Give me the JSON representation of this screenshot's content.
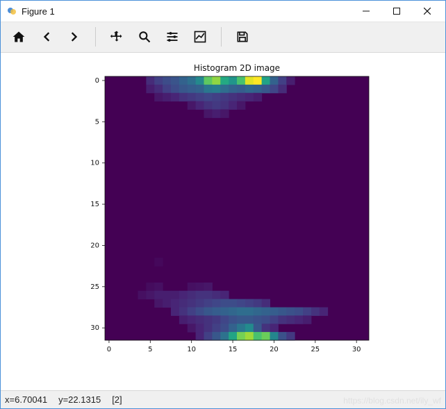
{
  "window": {
    "title": "Figure 1"
  },
  "toolbar": {
    "home": "Home",
    "back": "Back",
    "forward": "Forward",
    "pan": "Pan",
    "zoom": "Zoom",
    "subplots": "Configure subplots",
    "axes": "Edit axes",
    "save": "Save"
  },
  "status": {
    "x": "x=6.70041",
    "y": "y=22.1315",
    "val": "[2]"
  },
  "watermark": "https://blog.csdn.net/ily_wf",
  "chart_data": {
    "type": "heatmap",
    "title": "Histogram 2D image",
    "xlabel": "",
    "ylabel": "",
    "cmap": "viridis",
    "bg_value": 0,
    "xlim": [
      -0.5,
      31.5
    ],
    "ylim": [
      31.5,
      -0.5
    ],
    "xticks": [
      0,
      5,
      10,
      15,
      20,
      25,
      30
    ],
    "yticks": [
      0,
      5,
      10,
      15,
      20,
      25,
      30
    ],
    "width": 32,
    "height": 32,
    "sparse_cells": [
      {
        "y": 0,
        "x": 5,
        "v": 12
      },
      {
        "y": 0,
        "x": 6,
        "v": 18
      },
      {
        "y": 0,
        "x": 7,
        "v": 22
      },
      {
        "y": 0,
        "x": 8,
        "v": 25
      },
      {
        "y": 0,
        "x": 9,
        "v": 30
      },
      {
        "y": 0,
        "x": 10,
        "v": 35
      },
      {
        "y": 0,
        "x": 11,
        "v": 45
      },
      {
        "y": 0,
        "x": 12,
        "v": 72
      },
      {
        "y": 0,
        "x": 13,
        "v": 80
      },
      {
        "y": 0,
        "x": 14,
        "v": 58
      },
      {
        "y": 0,
        "x": 15,
        "v": 50
      },
      {
        "y": 0,
        "x": 16,
        "v": 68
      },
      {
        "y": 0,
        "x": 17,
        "v": 92
      },
      {
        "y": 0,
        "x": 18,
        "v": 96
      },
      {
        "y": 0,
        "x": 19,
        "v": 55
      },
      {
        "y": 0,
        "x": 20,
        "v": 30
      },
      {
        "y": 0,
        "x": 21,
        "v": 18
      },
      {
        "y": 0,
        "x": 22,
        "v": 8
      },
      {
        "y": 1,
        "x": 5,
        "v": 8
      },
      {
        "y": 1,
        "x": 6,
        "v": 12
      },
      {
        "y": 1,
        "x": 7,
        "v": 18
      },
      {
        "y": 1,
        "x": 8,
        "v": 22
      },
      {
        "y": 1,
        "x": 9,
        "v": 26
      },
      {
        "y": 1,
        "x": 10,
        "v": 28
      },
      {
        "y": 1,
        "x": 11,
        "v": 30
      },
      {
        "y": 1,
        "x": 12,
        "v": 38
      },
      {
        "y": 1,
        "x": 13,
        "v": 40
      },
      {
        "y": 1,
        "x": 14,
        "v": 34
      },
      {
        "y": 1,
        "x": 15,
        "v": 30
      },
      {
        "y": 1,
        "x": 16,
        "v": 28
      },
      {
        "y": 1,
        "x": 17,
        "v": 32
      },
      {
        "y": 1,
        "x": 18,
        "v": 30
      },
      {
        "y": 1,
        "x": 19,
        "v": 26
      },
      {
        "y": 1,
        "x": 20,
        "v": 20
      },
      {
        "y": 1,
        "x": 21,
        "v": 12
      },
      {
        "y": 2,
        "x": 6,
        "v": 6
      },
      {
        "y": 2,
        "x": 7,
        "v": 8
      },
      {
        "y": 2,
        "x": 8,
        "v": 10
      },
      {
        "y": 2,
        "x": 9,
        "v": 14
      },
      {
        "y": 2,
        "x": 10,
        "v": 16
      },
      {
        "y": 2,
        "x": 11,
        "v": 18
      },
      {
        "y": 2,
        "x": 12,
        "v": 20
      },
      {
        "y": 2,
        "x": 13,
        "v": 18
      },
      {
        "y": 2,
        "x": 14,
        "v": 16
      },
      {
        "y": 2,
        "x": 15,
        "v": 14
      },
      {
        "y": 2,
        "x": 16,
        "v": 12
      },
      {
        "y": 2,
        "x": 17,
        "v": 10
      },
      {
        "y": 2,
        "x": 18,
        "v": 8
      },
      {
        "y": 3,
        "x": 10,
        "v": 6
      },
      {
        "y": 3,
        "x": 11,
        "v": 10
      },
      {
        "y": 3,
        "x": 12,
        "v": 14
      },
      {
        "y": 3,
        "x": 13,
        "v": 16
      },
      {
        "y": 3,
        "x": 14,
        "v": 14
      },
      {
        "y": 3,
        "x": 15,
        "v": 10
      },
      {
        "y": 3,
        "x": 16,
        "v": 6
      },
      {
        "y": 4,
        "x": 12,
        "v": 6
      },
      {
        "y": 4,
        "x": 13,
        "v": 8
      },
      {
        "y": 4,
        "x": 14,
        "v": 6
      },
      {
        "y": 22,
        "x": 6,
        "v": 2
      },
      {
        "y": 25,
        "x": 5,
        "v": 3
      },
      {
        "y": 25,
        "x": 6,
        "v": 4
      },
      {
        "y": 25,
        "x": 10,
        "v": 4
      },
      {
        "y": 25,
        "x": 11,
        "v": 5
      },
      {
        "y": 25,
        "x": 12,
        "v": 6
      },
      {
        "y": 26,
        "x": 4,
        "v": 4
      },
      {
        "y": 26,
        "x": 5,
        "v": 6
      },
      {
        "y": 26,
        "x": 6,
        "v": 8
      },
      {
        "y": 26,
        "x": 7,
        "v": 8
      },
      {
        "y": 26,
        "x": 8,
        "v": 8
      },
      {
        "y": 26,
        "x": 9,
        "v": 10
      },
      {
        "y": 26,
        "x": 10,
        "v": 12
      },
      {
        "y": 26,
        "x": 11,
        "v": 14
      },
      {
        "y": 26,
        "x": 12,
        "v": 14
      },
      {
        "y": 26,
        "x": 13,
        "v": 12
      },
      {
        "y": 26,
        "x": 14,
        "v": 10
      },
      {
        "y": 27,
        "x": 6,
        "v": 6
      },
      {
        "y": 27,
        "x": 7,
        "v": 8
      },
      {
        "y": 27,
        "x": 8,
        "v": 10
      },
      {
        "y": 27,
        "x": 9,
        "v": 12
      },
      {
        "y": 27,
        "x": 10,
        "v": 14
      },
      {
        "y": 27,
        "x": 11,
        "v": 16
      },
      {
        "y": 27,
        "x": 12,
        "v": 18
      },
      {
        "y": 27,
        "x": 13,
        "v": 20
      },
      {
        "y": 27,
        "x": 14,
        "v": 22
      },
      {
        "y": 27,
        "x": 15,
        "v": 22
      },
      {
        "y": 27,
        "x": 16,
        "v": 20
      },
      {
        "y": 27,
        "x": 17,
        "v": 18
      },
      {
        "y": 27,
        "x": 18,
        "v": 16
      },
      {
        "y": 27,
        "x": 19,
        "v": 12
      },
      {
        "y": 28,
        "x": 8,
        "v": 10
      },
      {
        "y": 28,
        "x": 9,
        "v": 14
      },
      {
        "y": 28,
        "x": 10,
        "v": 18
      },
      {
        "y": 28,
        "x": 11,
        "v": 22
      },
      {
        "y": 28,
        "x": 12,
        "v": 26
      },
      {
        "y": 28,
        "x": 13,
        "v": 28
      },
      {
        "y": 28,
        "x": 14,
        "v": 30
      },
      {
        "y": 28,
        "x": 15,
        "v": 32
      },
      {
        "y": 28,
        "x": 16,
        "v": 34
      },
      {
        "y": 28,
        "x": 17,
        "v": 34
      },
      {
        "y": 28,
        "x": 18,
        "v": 32
      },
      {
        "y": 28,
        "x": 19,
        "v": 30
      },
      {
        "y": 28,
        "x": 20,
        "v": 28
      },
      {
        "y": 28,
        "x": 21,
        "v": 26
      },
      {
        "y": 28,
        "x": 22,
        "v": 24
      },
      {
        "y": 28,
        "x": 23,
        "v": 22
      },
      {
        "y": 28,
        "x": 24,
        "v": 18
      },
      {
        "y": 28,
        "x": 25,
        "v": 14
      },
      {
        "y": 28,
        "x": 26,
        "v": 10
      },
      {
        "y": 29,
        "x": 9,
        "v": 8
      },
      {
        "y": 29,
        "x": 10,
        "v": 10
      },
      {
        "y": 29,
        "x": 11,
        "v": 12
      },
      {
        "y": 29,
        "x": 12,
        "v": 14
      },
      {
        "y": 29,
        "x": 13,
        "v": 16
      },
      {
        "y": 29,
        "x": 14,
        "v": 20
      },
      {
        "y": 29,
        "x": 15,
        "v": 24
      },
      {
        "y": 29,
        "x": 16,
        "v": 26
      },
      {
        "y": 29,
        "x": 17,
        "v": 26
      },
      {
        "y": 29,
        "x": 18,
        "v": 24
      },
      {
        "y": 29,
        "x": 19,
        "v": 22
      },
      {
        "y": 29,
        "x": 20,
        "v": 18
      },
      {
        "y": 29,
        "x": 21,
        "v": 14
      },
      {
        "y": 29,
        "x": 22,
        "v": 12
      },
      {
        "y": 29,
        "x": 23,
        "v": 10
      },
      {
        "y": 29,
        "x": 24,
        "v": 8
      },
      {
        "y": 30,
        "x": 10,
        "v": 6
      },
      {
        "y": 30,
        "x": 11,
        "v": 10
      },
      {
        "y": 30,
        "x": 12,
        "v": 14
      },
      {
        "y": 30,
        "x": 13,
        "v": 18
      },
      {
        "y": 30,
        "x": 14,
        "v": 22
      },
      {
        "y": 30,
        "x": 15,
        "v": 30
      },
      {
        "y": 30,
        "x": 16,
        "v": 38
      },
      {
        "y": 30,
        "x": 17,
        "v": 46
      },
      {
        "y": 30,
        "x": 18,
        "v": 26
      },
      {
        "y": 30,
        "x": 19,
        "v": 14
      },
      {
        "y": 30,
        "x": 20,
        "v": 10
      },
      {
        "y": 31,
        "x": 11,
        "v": 10
      },
      {
        "y": 31,
        "x": 12,
        "v": 18
      },
      {
        "y": 31,
        "x": 13,
        "v": 26
      },
      {
        "y": 31,
        "x": 14,
        "v": 36
      },
      {
        "y": 31,
        "x": 15,
        "v": 56
      },
      {
        "y": 31,
        "x": 16,
        "v": 76
      },
      {
        "y": 31,
        "x": 17,
        "v": 82
      },
      {
        "y": 31,
        "x": 18,
        "v": 68
      },
      {
        "y": 31,
        "x": 19,
        "v": 74
      },
      {
        "y": 31,
        "x": 20,
        "v": 44
      },
      {
        "y": 31,
        "x": 21,
        "v": 24
      },
      {
        "y": 31,
        "x": 22,
        "v": 16
      }
    ]
  }
}
